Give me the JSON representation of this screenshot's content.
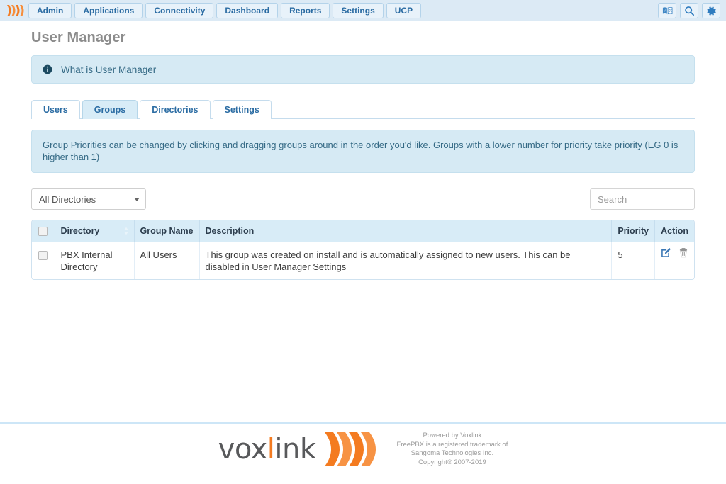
{
  "topnav": {
    "logo_icon": "voxlink-wave-logo",
    "items": [
      {
        "label": "Admin"
      },
      {
        "label": "Applications"
      },
      {
        "label": "Connectivity"
      },
      {
        "label": "Dashboard"
      },
      {
        "label": "Reports"
      },
      {
        "label": "Settings"
      },
      {
        "label": "UCP"
      }
    ],
    "right_icons": [
      {
        "name": "language-icon"
      },
      {
        "name": "search-icon"
      },
      {
        "name": "gear-icon"
      }
    ]
  },
  "page": {
    "title": "User Manager"
  },
  "info_alert": {
    "icon": "info-circle-icon",
    "text": "What is User Manager"
  },
  "tabs": [
    {
      "label": "Users",
      "active": false
    },
    {
      "label": "Groups",
      "active": true
    },
    {
      "label": "Directories",
      "active": false
    },
    {
      "label": "Settings",
      "active": false
    }
  ],
  "priority_alert": {
    "text": "Group Priorities can be changed by clicking and dragging groups around in the order you'd like. Groups with a lower number for priority take priority (EG 0 is higher than 1)"
  },
  "toolbar": {
    "directory_filter": {
      "selected": "All Directories",
      "options": [
        "All Directories",
        "PBX Internal Directory"
      ]
    },
    "search": {
      "value": "",
      "placeholder": "Search"
    }
  },
  "table": {
    "headers": {
      "select_all": "",
      "directory": "Directory",
      "group_name": "Group Name",
      "description": "Description",
      "priority": "Priority",
      "action": "Action"
    },
    "rows": [
      {
        "directory": "PBX Internal Directory",
        "group_name": "All Users",
        "description": "This group was created on install and is automatically assigned to new users. This can be disabled in User Manager Settings",
        "priority": "5",
        "actions": [
          "edit-icon",
          "delete-icon"
        ]
      }
    ]
  },
  "footer": {
    "logo_text_part1": "vox",
    "logo_text_i": "l",
    "logo_text_part2": "ink",
    "logo_icon": "voxlink-wave-logo",
    "line1": "Powered by Voxlink",
    "line2": "FreePBX is a registered trademark of",
    "line3": "Sangoma Technologies Inc.",
    "line4": "Copyright® 2007-2019"
  },
  "colors": {
    "brand_orange": "#f47b20",
    "nav_blue": "#2b6ca3",
    "topbar_bg": "#dceaf5",
    "alert_bg": "#d6eaf4",
    "tab_active_bg": "#d8ecf7",
    "table_header_bg": "#d8ecf7",
    "title_gray": "#8c8c8c"
  }
}
